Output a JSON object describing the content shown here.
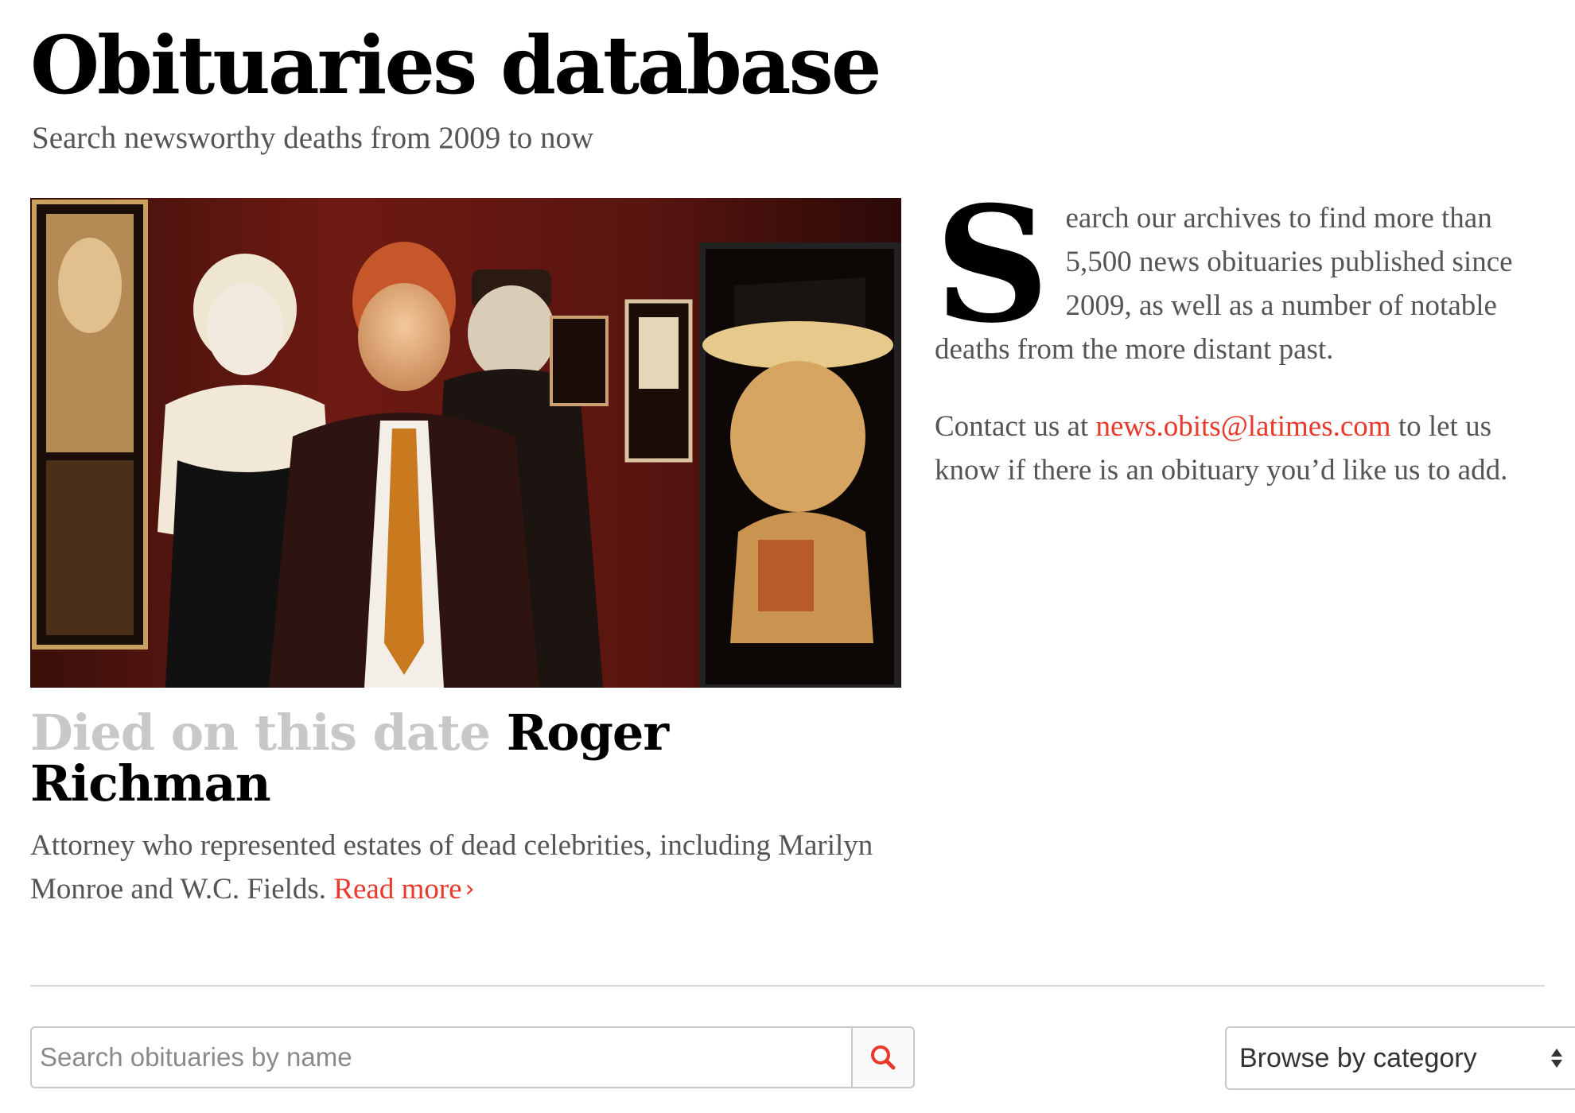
{
  "header": {
    "title": "Obituaries database",
    "subtitle": "Search newsworthy deaths from 2009 to now"
  },
  "feature": {
    "kicker": "Died on this date",
    "name": "Roger Richman",
    "description": "Attorney who represented estates of dead celebrities, including Marilyn Monroe and W.C. Fields.",
    "read_more_label": "Read more",
    "read_more_icon": "chevron-right-icon"
  },
  "intro": {
    "drop_cap": "S",
    "lead_text": "earch our archives to find more than 5,500 news obituaries published since 2009, as well as a number of notable deaths from the more distant past.",
    "contact_prefix": "Contact us at ",
    "contact_email": "news.obits@latimes.com",
    "contact_suffix": " to let us know if there is an obituary you’d like us to add."
  },
  "search": {
    "placeholder": "Search obituaries by name",
    "value": "",
    "button_icon": "search-icon"
  },
  "category_select": {
    "selected": "Browse by category",
    "icon": "select-arrows-icon"
  },
  "colors": {
    "accent": "#e8392b",
    "kicker_gray": "#c8c8c8",
    "body_text": "#555555"
  }
}
